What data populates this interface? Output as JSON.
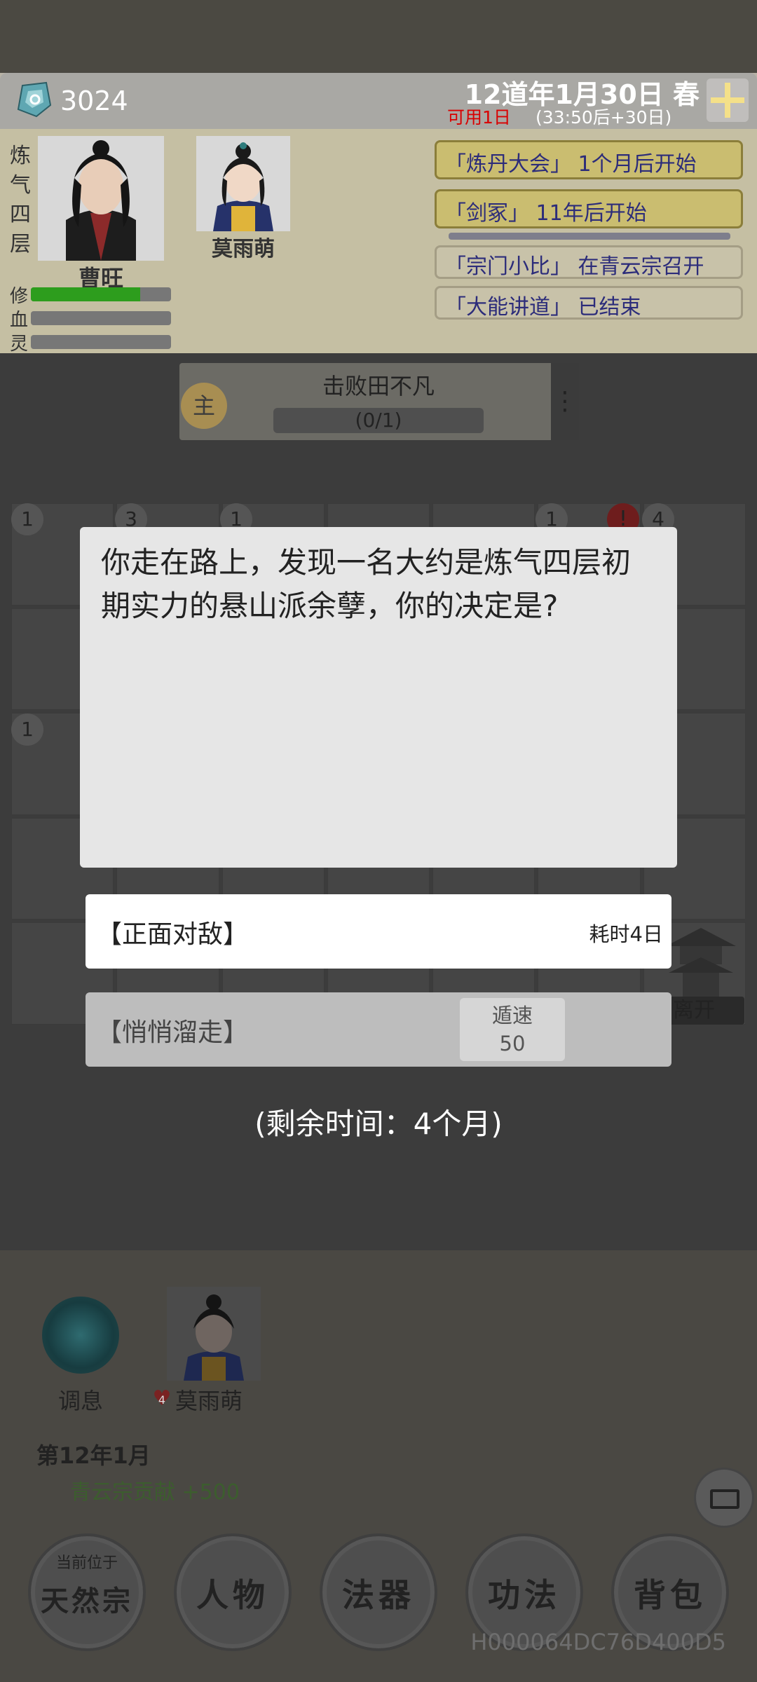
{
  "header": {
    "currency": "3024",
    "date": "12道年1月30日 春",
    "available": "可用1日",
    "countdown": "(33:50后+30日)"
  },
  "character": {
    "realm": [
      "炼",
      "气",
      "四",
      "层"
    ],
    "name": "曹旺",
    "stats": [
      {
        "label": "修",
        "fill": 0.78
      },
      {
        "label": "血",
        "fill": 0.0
      },
      {
        "label": "灵",
        "fill": 0.0
      }
    ]
  },
  "companion": {
    "name": "莫雨萌"
  },
  "events": [
    {
      "text": "「炼丹大会」 1个月后开始"
    },
    {
      "text": "「剑冢」 11年后开始"
    },
    {
      "text": "「宗门小比」 在青云宗召开"
    },
    {
      "text": "「大能讲道」 已结束"
    }
  ],
  "quest": {
    "icon_label": "主",
    "title": "击败田不凡",
    "progress": "(0/1)"
  },
  "map": {
    "cell_numbers": [
      "1",
      "3",
      "1",
      "1",
      "4",
      "1"
    ],
    "leave_label": "离开"
  },
  "dialog": {
    "text": "你走在路上，发现一名大约是炼气四层初期实力的悬山派余孽，你的决定是?",
    "choices": [
      {
        "label": "【正面对敌】",
        "cost": "耗时4日"
      },
      {
        "label": "【悄悄溜走】",
        "req_line1": "遁速",
        "req_line2": "50"
      }
    ],
    "remaining": "(剩余时间：4个月)"
  },
  "bottom": {
    "action1": "调息",
    "companion_name": "莫雨萌",
    "heart_count": "4",
    "log_date": "第12年1月",
    "log_entry": "青云宗贡献 +500",
    "location_sub": "当前位于",
    "location_main": "天然宗",
    "nav": [
      "人物",
      "法器",
      "功法",
      "背包"
    ],
    "device_id": "H000064DC76D400D5"
  },
  "colors": {
    "quest_icon": "#a88e52",
    "event_highlight": "#cabd70",
    "event_text": "#2c2c7a",
    "available_text": "#d90000",
    "progress_green": "#2d9d1d"
  }
}
